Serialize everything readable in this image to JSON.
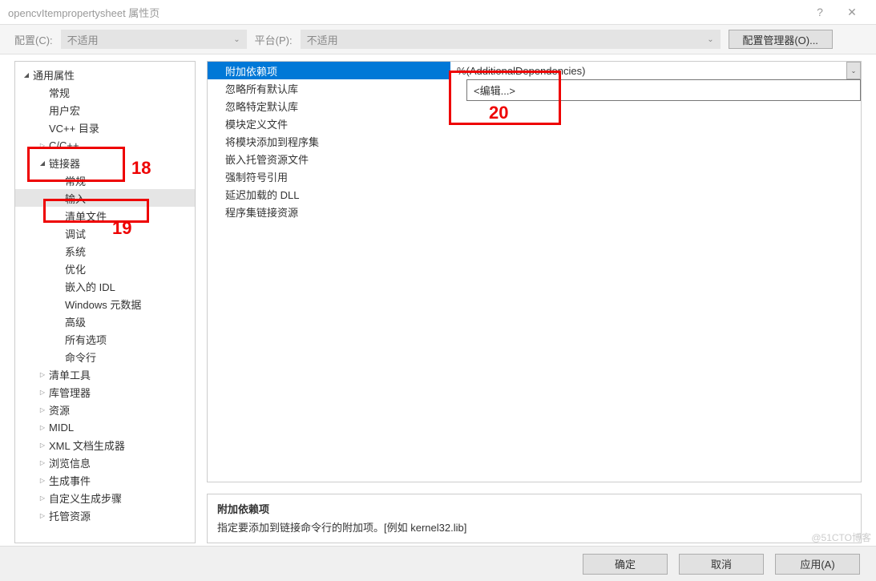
{
  "window": {
    "title": "opencvItempropertysheet 属性页",
    "help": "?",
    "close": "✕"
  },
  "toolbar": {
    "config_label": "配置(C):",
    "config_value": "不适用",
    "platform_label": "平台(P):",
    "platform_value": "不适用",
    "manager_button": "配置管理器(O)..."
  },
  "tree": [
    {
      "label": "通用属性",
      "indent": 0,
      "expand": "open"
    },
    {
      "label": "常规",
      "indent": 1,
      "expand": "none"
    },
    {
      "label": "用户宏",
      "indent": 1,
      "expand": "none"
    },
    {
      "label": "VC++ 目录",
      "indent": 1,
      "expand": "none"
    },
    {
      "label": "C/C++",
      "indent": 1,
      "expand": "closed"
    },
    {
      "label": "链接器",
      "indent": 1,
      "expand": "open"
    },
    {
      "label": "常规",
      "indent": 2,
      "expand": "none"
    },
    {
      "label": "输入",
      "indent": 2,
      "expand": "none",
      "selected": true
    },
    {
      "label": "清单文件",
      "indent": 2,
      "expand": "none"
    },
    {
      "label": "调试",
      "indent": 2,
      "expand": "none"
    },
    {
      "label": "系统",
      "indent": 2,
      "expand": "none"
    },
    {
      "label": "优化",
      "indent": 2,
      "expand": "none"
    },
    {
      "label": "嵌入的 IDL",
      "indent": 2,
      "expand": "none"
    },
    {
      "label": "Windows 元数据",
      "indent": 2,
      "expand": "none"
    },
    {
      "label": "高级",
      "indent": 2,
      "expand": "none"
    },
    {
      "label": "所有选项",
      "indent": 2,
      "expand": "none"
    },
    {
      "label": "命令行",
      "indent": 2,
      "expand": "none"
    },
    {
      "label": "清单工具",
      "indent": 1,
      "expand": "closed"
    },
    {
      "label": "库管理器",
      "indent": 1,
      "expand": "closed"
    },
    {
      "label": "资源",
      "indent": 1,
      "expand": "closed"
    },
    {
      "label": "MIDL",
      "indent": 1,
      "expand": "closed"
    },
    {
      "label": "XML 文档生成器",
      "indent": 1,
      "expand": "closed"
    },
    {
      "label": "浏览信息",
      "indent": 1,
      "expand": "closed"
    },
    {
      "label": "生成事件",
      "indent": 1,
      "expand": "closed"
    },
    {
      "label": "自定义生成步骤",
      "indent": 1,
      "expand": "closed"
    },
    {
      "label": "托管资源",
      "indent": 1,
      "expand": "closed"
    }
  ],
  "grid": [
    {
      "key": "附加依赖项",
      "value": "%(AdditionalDependencies)",
      "selected": true,
      "has_dropdown": true
    },
    {
      "key": "忽略所有默认库",
      "value": ""
    },
    {
      "key": "忽略特定默认库",
      "value": ""
    },
    {
      "key": "模块定义文件",
      "value": ""
    },
    {
      "key": "将模块添加到程序集",
      "value": ""
    },
    {
      "key": "嵌入托管资源文件",
      "value": ""
    },
    {
      "key": "强制符号引用",
      "value": ""
    },
    {
      "key": "延迟加载的 DLL",
      "value": ""
    },
    {
      "key": "程序集链接资源",
      "value": ""
    }
  ],
  "dropdown": {
    "option": "<编辑...>"
  },
  "description": {
    "title": "附加依赖项",
    "text": "指定要添加到链接命令行的附加项。[例如 kernel32.lib]"
  },
  "footer": {
    "ok": "确定",
    "cancel": "取消",
    "apply": "应用(A)"
  },
  "annotations": {
    "a18": "18",
    "a19": "19",
    "a20": "20"
  },
  "watermark": "@51CTO博客"
}
